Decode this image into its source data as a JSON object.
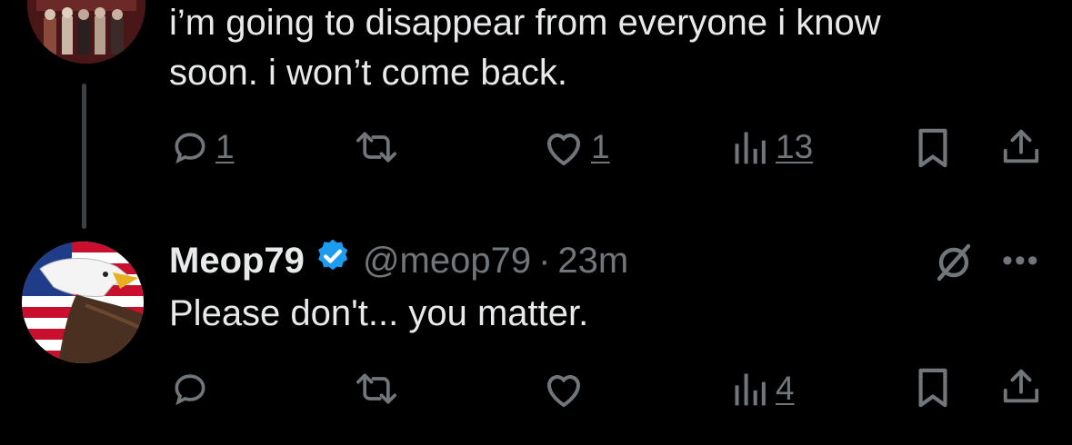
{
  "tweet1": {
    "text_line1": "i’m going to disappear from everyone i know",
    "text_line2": "soon. i won’t come back.",
    "replies": "1",
    "likes": "1",
    "views": "13"
  },
  "tweet2": {
    "name": "Meop79",
    "handle": "@meop79",
    "dot": "·",
    "time": "23m",
    "text": "Please don't... you matter.",
    "views": "4"
  },
  "icons": {
    "reply": "reply-icon",
    "retweet": "retweet-icon",
    "like": "heart-icon",
    "views": "views-chart-icon",
    "bookmark": "bookmark-icon",
    "share": "share-icon",
    "verified": "verified-badge-icon",
    "grok": "grok-icon",
    "more": "more-icon"
  },
  "colors": {
    "background": "#000000",
    "text": "#e7e9ea",
    "muted": "#71767b",
    "verified": "#1d9bf0"
  }
}
